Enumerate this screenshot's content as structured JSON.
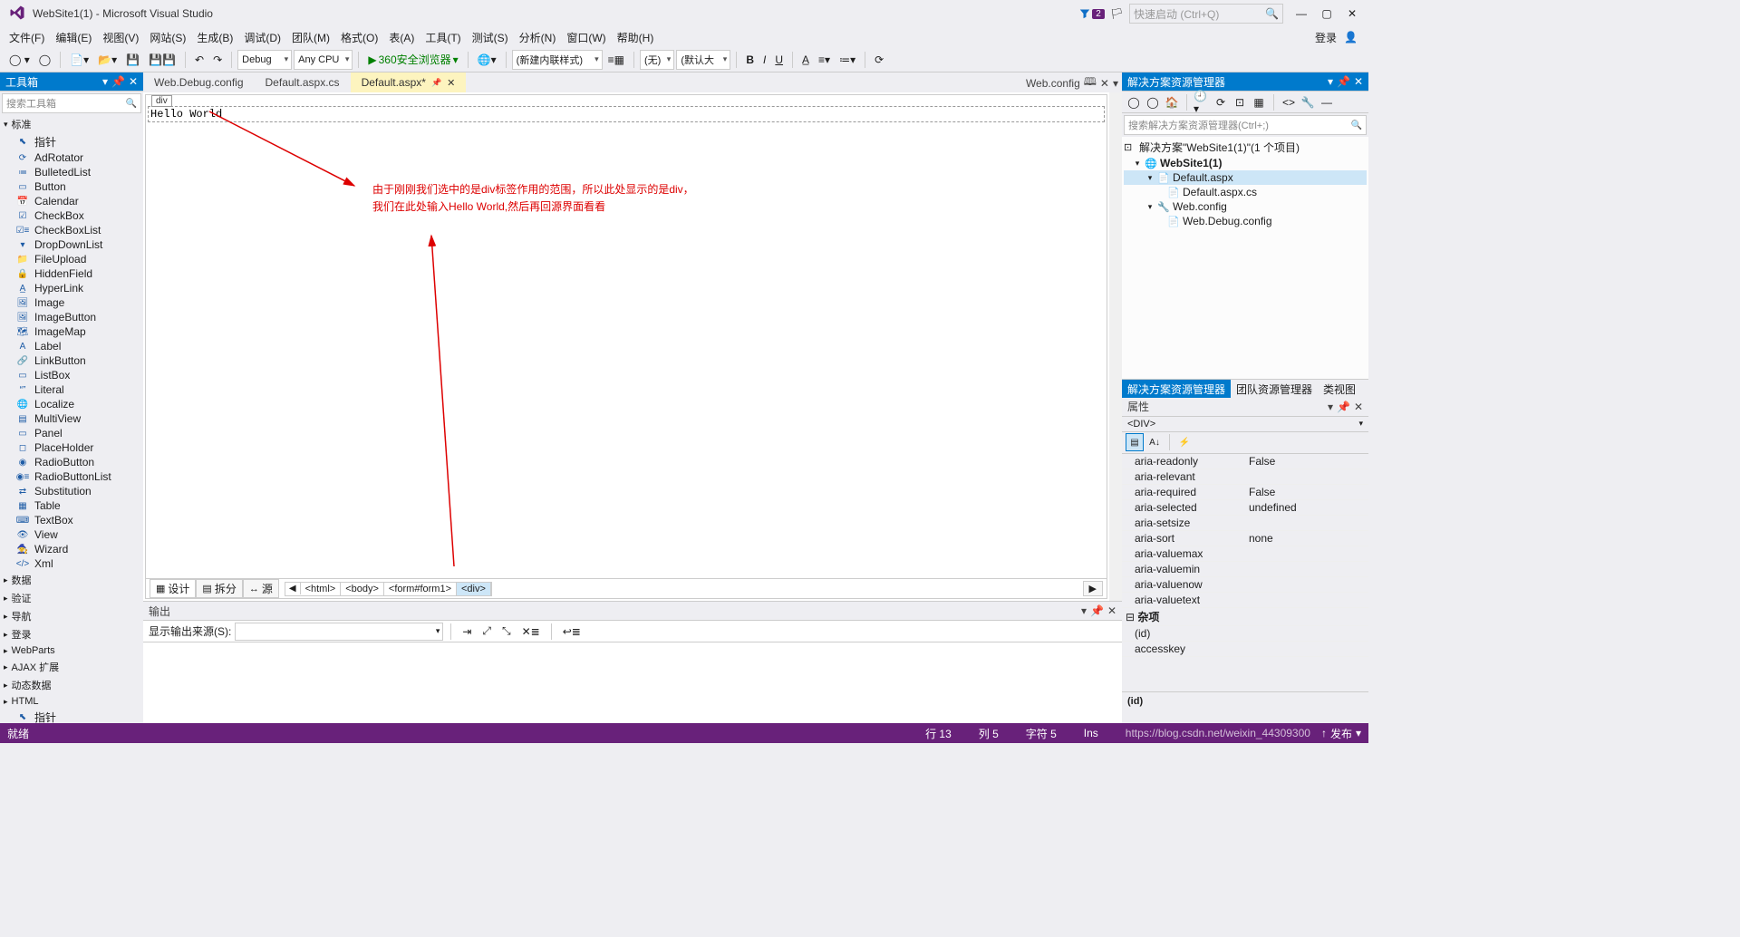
{
  "title": "WebSite1(1) - Microsoft Visual Studio",
  "badge_count": "2",
  "quicklaunch_placeholder": "快速启动 (Ctrl+Q)",
  "menu": [
    "文件(F)",
    "编辑(E)",
    "视图(V)",
    "网站(S)",
    "生成(B)",
    "调试(D)",
    "团队(M)",
    "格式(O)",
    "表(A)",
    "工具(T)",
    "测试(S)",
    "分析(N)",
    "窗口(W)",
    "帮助(H)"
  ],
  "menu_right_login": "登录",
  "toolbar": {
    "config": "Debug",
    "platform": "Any CPU",
    "run_target": "360安全浏览器",
    "style_target": "(新建内联样式)",
    "default_font": "(默认大",
    "none": "(无)"
  },
  "toolbox": {
    "title": "工具箱",
    "search": "搜索工具箱",
    "cat_standard": "标准",
    "items": [
      "指针",
      "AdRotator",
      "BulletedList",
      "Button",
      "Calendar",
      "CheckBox",
      "CheckBoxList",
      "DropDownList",
      "FileUpload",
      "HiddenField",
      "HyperLink",
      "Image",
      "ImageButton",
      "ImageMap",
      "Label",
      "LinkButton",
      "ListBox",
      "Literal",
      "Localize",
      "MultiView",
      "Panel",
      "PlaceHolder",
      "RadioButton",
      "RadioButtonList",
      "Substitution",
      "Table",
      "TextBox",
      "View",
      "Wizard",
      "Xml"
    ],
    "cats": [
      "数据",
      "验证",
      "导航",
      "登录",
      "WebParts",
      "AJAX 扩展",
      "动态数据",
      "HTML"
    ],
    "pointer2": "指针"
  },
  "tabs": {
    "t0": "Web.Debug.config",
    "t1": "Default.aspx.cs",
    "t2": "Default.aspx*",
    "right": "Web.config"
  },
  "designer": {
    "tag": "div",
    "text": "Hello World",
    "annotation_l1": "由于刚刚我们选中的是div标签作用的范围，所以此处显示的是div，",
    "annotation_l2": "我们在此处输入Hello World,然后再回源界面看看"
  },
  "des_footer": {
    "design": "设计",
    "split": "拆分",
    "source": "源",
    "bc": [
      "<html>",
      "<body>",
      "<form#form1>",
      "<div>"
    ]
  },
  "output": {
    "title": "输出",
    "showfrom_label": "显示输出来源(S):"
  },
  "solution": {
    "title": "解决方案资源管理器",
    "search": "搜索解决方案资源管理器(Ctrl+;)",
    "root": "解决方案\"WebSite1(1)\"(1 个项目)",
    "proj": "WebSite1(1)",
    "f1": "Default.aspx",
    "f1a": "Default.aspx.cs",
    "f2": "Web.config",
    "f2a": "Web.Debug.config",
    "tabs": [
      "解决方案资源管理器",
      "团队资源管理器",
      "类视图"
    ]
  },
  "props": {
    "title": "属性",
    "obj": "<DIV>",
    "rows": [
      {
        "n": "aria-readonly",
        "v": "False"
      },
      {
        "n": "aria-relevant",
        "v": ""
      },
      {
        "n": "aria-required",
        "v": "False"
      },
      {
        "n": "aria-selected",
        "v": "undefined"
      },
      {
        "n": "aria-setsize",
        "v": ""
      },
      {
        "n": "aria-sort",
        "v": "none"
      },
      {
        "n": "aria-valuemax",
        "v": ""
      },
      {
        "n": "aria-valuemin",
        "v": ""
      },
      {
        "n": "aria-valuenow",
        "v": ""
      },
      {
        "n": "aria-valuetext",
        "v": ""
      }
    ],
    "cat_misc": "杂项",
    "misc_rows": [
      {
        "n": "(id)",
        "v": ""
      },
      {
        "n": "accesskey",
        "v": ""
      }
    ],
    "desc": "(id)"
  },
  "status": {
    "ready": "就绪",
    "line": "行 13",
    "col": "列 5",
    "char": "字符 5",
    "ins": "Ins",
    "watermark": "https://blog.csdn.net/weixin_44309300",
    "publish": "发布"
  }
}
